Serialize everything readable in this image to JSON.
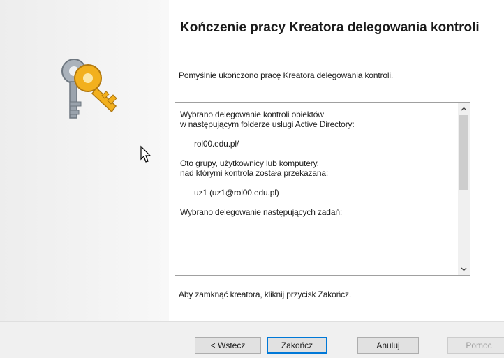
{
  "wizard": {
    "title": "Kończenie pracy Kreatora delegowania kontroli",
    "success_message": "Pomyślnie ukończono pracę Kreatora delegowania kontroli.",
    "summary": {
      "line1": "Wybrano delegowanie kontroli obiektów",
      "line2": "w następującym folderze usługi Active Directory:",
      "folder": "rol00.edu.pl/",
      "line3": "Oto grupy, użytkownicy lub komputery,",
      "line4": "nad którymi kontrola została przekazana:",
      "principal": "uz1 (uz1@rol00.edu.pl)",
      "line5": "Wybrano delegowanie następujących zadań:"
    },
    "closing_message": "Aby zamknąć kreatora, kliknij przycisk Zakończ."
  },
  "buttons": {
    "back": "< Wstecz",
    "finish": "Zakończ",
    "cancel": "Anuluj",
    "help": "Pomoc"
  },
  "icons": {
    "side_image": "keys-icon",
    "scroll_up": "chevron-up-icon",
    "scroll_down": "chevron-down-icon",
    "pointer": "mouse-cursor-icon"
  },
  "colors": {
    "key_gold": "#f2b01e",
    "key_silver": "#9aa3ad",
    "focus_border": "#0078d7"
  }
}
